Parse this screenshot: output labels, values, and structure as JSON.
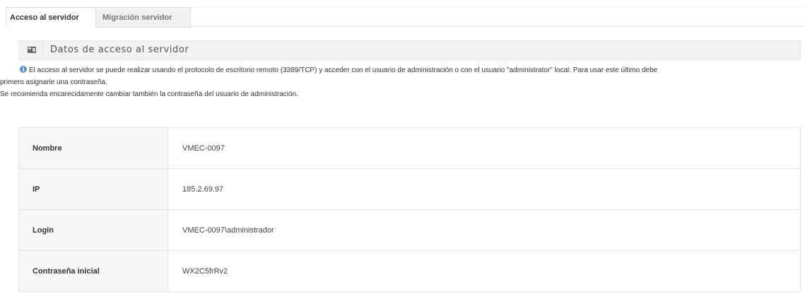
{
  "tabs": [
    {
      "label": "Acceso al servidor",
      "active": true
    },
    {
      "label": "Migración servidor",
      "active": false
    }
  ],
  "section": {
    "icon": "id-card-icon",
    "title": "Datos de acceso al servidor"
  },
  "info": {
    "icon": "info-icon",
    "line1": "El acceso al servidor se puede realizar usando el protocolo de escritorio remoto (3389/TCP) y acceder con el usuario de administración o con el usuario \"administrator\" local. Para usar este último debe",
    "line2": "primero asignarle una contraseña.",
    "line3": "Se recomienda encarecidamente cambiar también la contraseña del usuario de administración."
  },
  "details": [
    {
      "label": "Nombre",
      "value": "VMEC-0097"
    },
    {
      "label": "IP",
      "value": "185.2.69.97"
    },
    {
      "label": "Login",
      "value": "VMEC-0097\\administrador"
    },
    {
      "label": "Contraseña inicial",
      "value": "WX2C5frRv2"
    }
  ],
  "colors": {
    "header_bg": "#f2f2f2",
    "info_icon": "#5b8fc9",
    "key_bg": "#f7f7f7",
    "border": "#e3e3e3"
  }
}
